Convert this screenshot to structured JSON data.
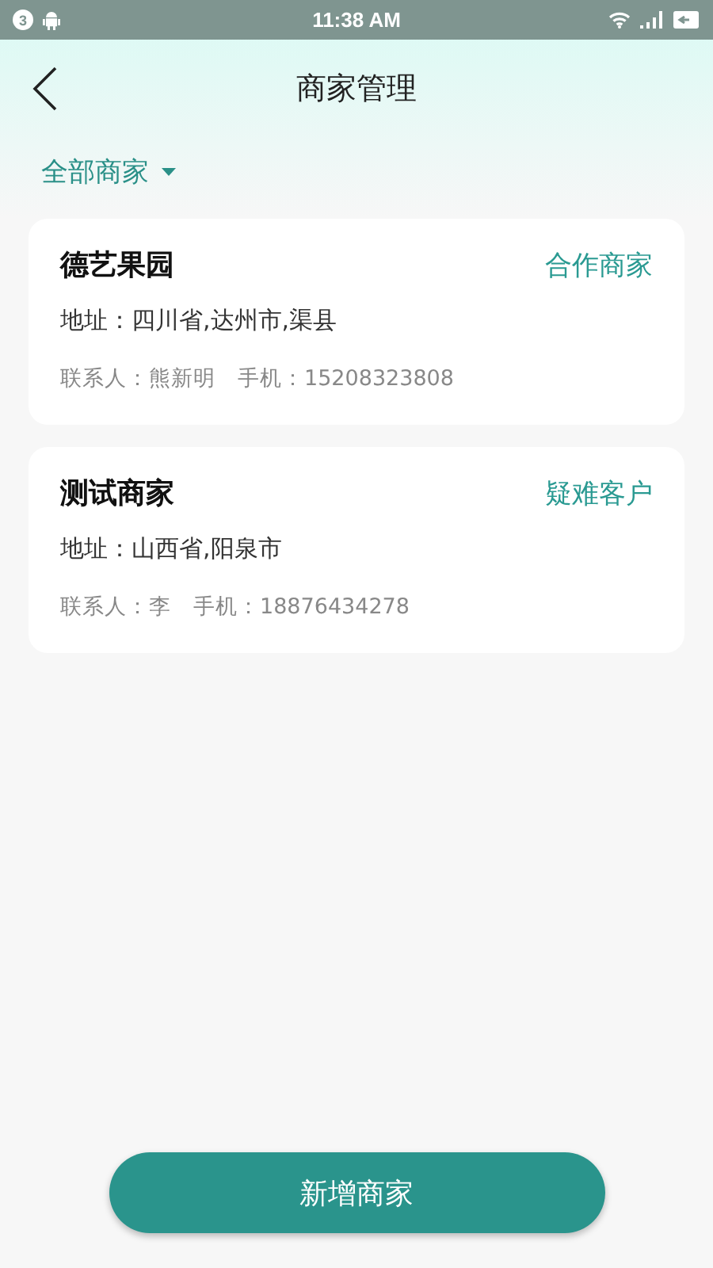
{
  "status_bar": {
    "notification_count": "3",
    "time": "11:38 AM"
  },
  "header": {
    "title": "商家管理"
  },
  "filter": {
    "label": "全部商家"
  },
  "merchants": [
    {
      "name": "德艺果园",
      "tag": "合作商家",
      "address": "地址：四川省,达州市,渠县",
      "contact": "联系人：熊新明",
      "phone": "手机：15208323808"
    },
    {
      "name": "测试商家",
      "tag": "疑难客户",
      "address": "地址：山西省,阳泉市",
      "contact": "联系人：李",
      "phone": "手机：18876434278"
    }
  ],
  "add_button": {
    "label": "新增商家"
  }
}
